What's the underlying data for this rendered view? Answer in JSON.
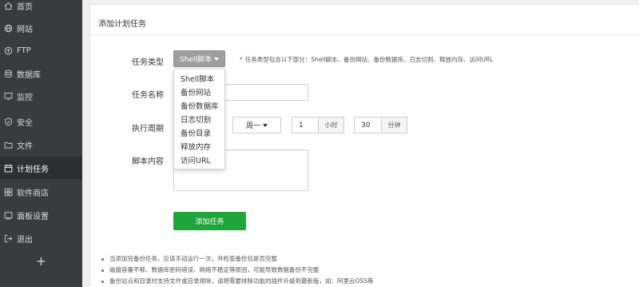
{
  "sidebar": {
    "items": [
      {
        "label": "首页",
        "icon": "home-icon"
      },
      {
        "label": "网站",
        "icon": "globe-icon"
      },
      {
        "label": "FTP",
        "icon": "ftp-icon"
      },
      {
        "label": "数据库",
        "icon": "database-icon"
      },
      {
        "label": "监控",
        "icon": "monitor-icon"
      },
      {
        "label": "安全",
        "icon": "shield-icon"
      },
      {
        "label": "文件",
        "icon": "folder-icon"
      },
      {
        "label": "计划任务",
        "icon": "calendar-icon",
        "active": true
      },
      {
        "label": "软件商店",
        "icon": "store-icon"
      },
      {
        "label": "面板设置",
        "icon": "settings-icon"
      },
      {
        "label": "退出",
        "icon": "logout-icon"
      }
    ],
    "add_label": "+"
  },
  "panel": {
    "title": "添加计划任务",
    "task_type": {
      "label": "任务类型",
      "value": "Shell脚本",
      "hint_star": "*",
      "hint": "任务类型包含以下部分：Shell脚本、备份网站、备份数据库、日志切割、释放内存、访问URL"
    },
    "task_name": {
      "label": "任务名称",
      "value": ""
    },
    "schedule": {
      "label": "执行周期",
      "weekday": "周一",
      "hour": "1",
      "hour_unit": "小时",
      "minute": "30",
      "minute_unit": "分钟"
    },
    "script": {
      "label": "脚本内容",
      "value": ""
    },
    "submit_label": "添加任务",
    "notes": [
      "当添加完备份任务，应该手动运行一次，并检查备份包是否完整",
      "磁盘容量不够、数据库密码错误、网络不稳定等原因，可能导致数据备份不完整",
      "备份站点和目录时支持文件或目录排除，请将需要排除功能的插件升级到最新版，如：阿里云OSS等"
    ]
  },
  "dropdown": {
    "options": [
      "Shell脚本",
      "备份网站",
      "备份数据库",
      "日志切割",
      "备份目录",
      "释放内存",
      "访问URL"
    ]
  },
  "colors": {
    "sidebar_bg": "#363d40",
    "accent_green": "#20a53a",
    "required_star": "#e53935"
  }
}
